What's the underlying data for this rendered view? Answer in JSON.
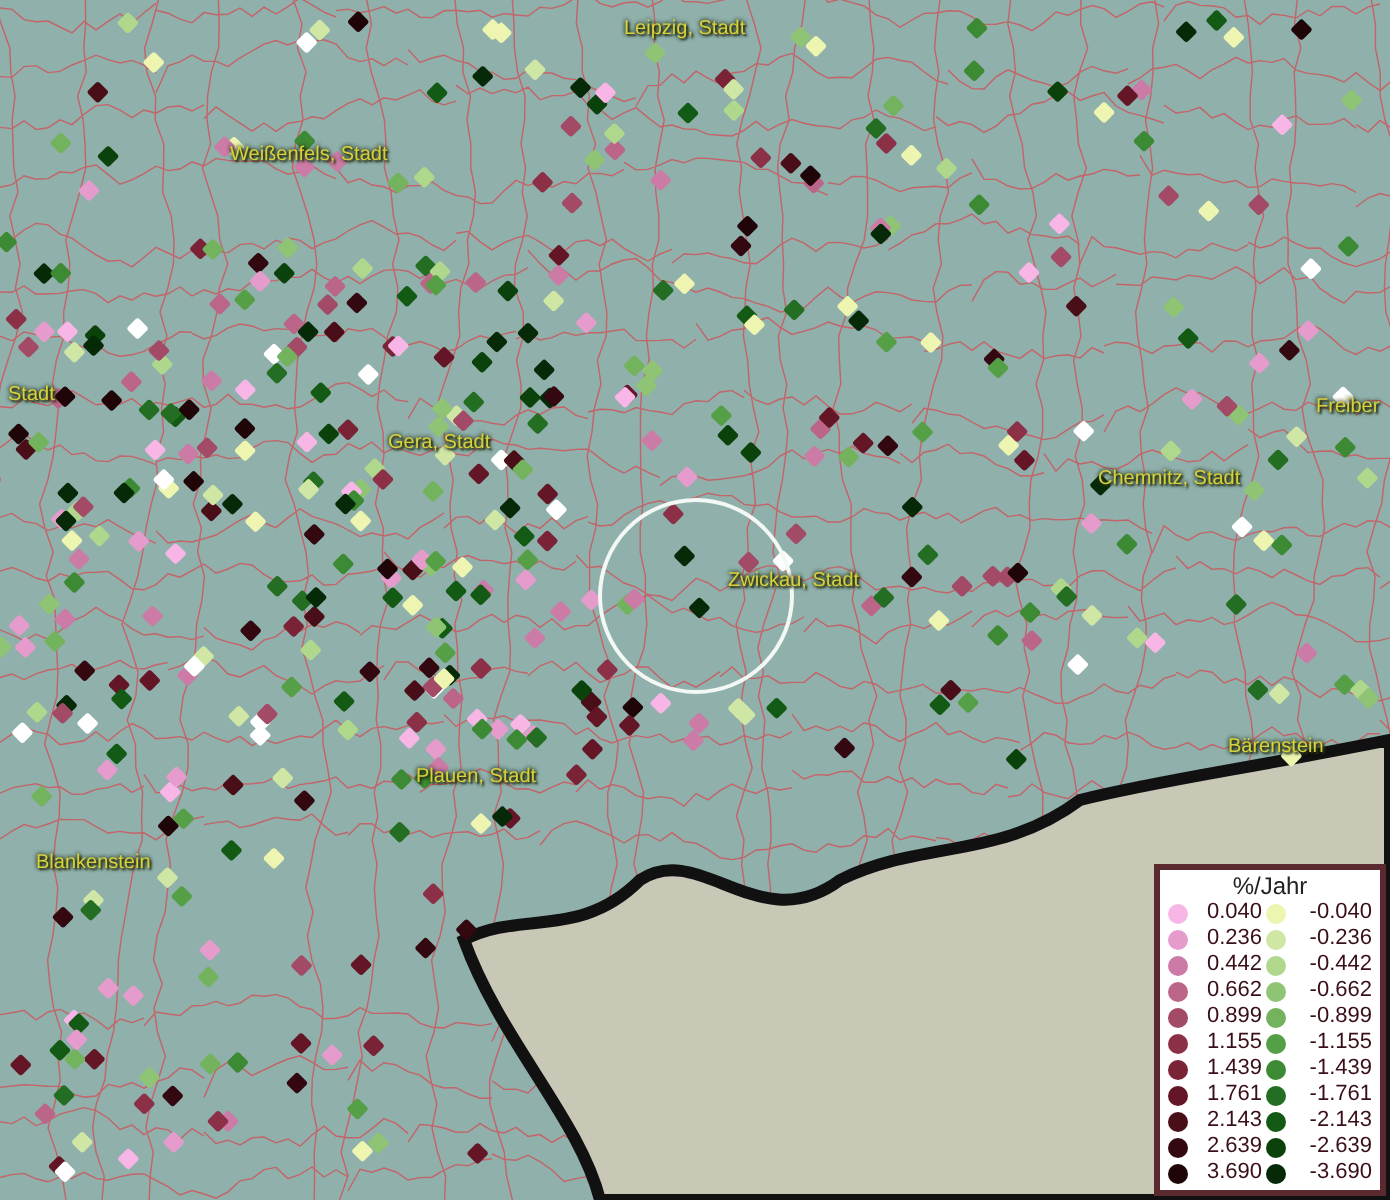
{
  "map_labels": [
    "Leipzig, Stadt",
    "Weißenfels, Stadt",
    "Stadt",
    "Gera, Stadt",
    "Chemnitz, Stadt",
    "Freiber",
    "Zwickau, Stadt",
    "Plauen, Stadt",
    "Bärenstein",
    "Blankenstein"
  ],
  "legend": {
    "title": "%/Jahr",
    "rows": [
      {
        "positive": {
          "label": "0.040",
          "color": "#f7b6e6"
        },
        "negative": {
          "label": "-0.040",
          "color": "#eef5b0"
        }
      },
      {
        "positive": {
          "label": "0.236",
          "color": "#e59ccc"
        },
        "negative": {
          "label": "-0.236",
          "color": "#cfe6a4"
        }
      },
      {
        "positive": {
          "label": "0.442",
          "color": "#cc7ba6"
        },
        "negative": {
          "label": "-0.442",
          "color": "#b0d88c"
        }
      },
      {
        "positive": {
          "label": "0.662",
          "color": "#bb6688"
        },
        "negative": {
          "label": "-0.662",
          "color": "#8fc474"
        }
      },
      {
        "positive": {
          "label": "0.899",
          "color": "#a24a66"
        },
        "negative": {
          "label": "-0.899",
          "color": "#74b35e"
        }
      },
      {
        "positive": {
          "label": "1.155",
          "color": "#8c3048"
        },
        "negative": {
          "label": "-1.155",
          "color": "#55a046"
        }
      },
      {
        "positive": {
          "label": "1.439",
          "color": "#7a2236"
        },
        "negative": {
          "label": "-1.439",
          "color": "#3c8a34"
        }
      },
      {
        "positive": {
          "label": "1.761",
          "color": "#641626"
        },
        "negative": {
          "label": "-1.761",
          "color": "#236e22"
        }
      },
      {
        "positive": {
          "label": "2.143",
          "color": "#4a0e18"
        },
        "negative": {
          "label": "-2.143",
          "color": "#135a14"
        }
      },
      {
        "positive": {
          "label": "2.639",
          "color": "#330810"
        },
        "negative": {
          "label": "-2.639",
          "color": "#0b420c"
        }
      },
      {
        "positive": {
          "label": "3.690",
          "color": "#200508"
        },
        "negative": {
          "label": "-3.690",
          "color": "#062a08"
        }
      }
    ]
  }
}
